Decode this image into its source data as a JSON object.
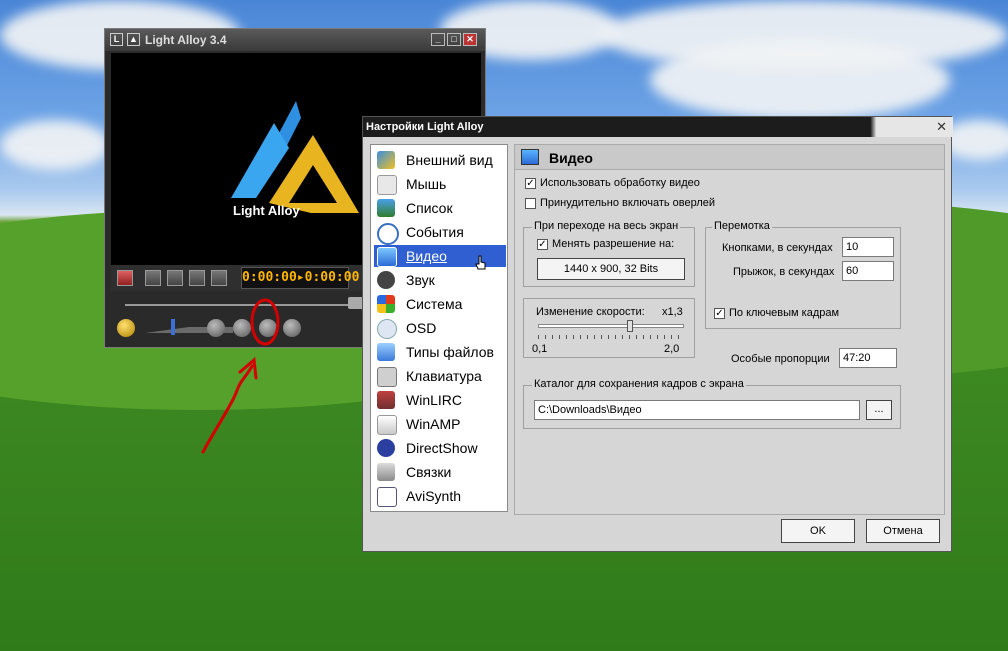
{
  "player": {
    "title": "Light Alloy 3.4",
    "logo_text": "Light Alloy",
    "time": "0:00:00▸0:00:00"
  },
  "dialog": {
    "title": "Настройки Light Alloy",
    "close_glyph": "✕",
    "sidebar": [
      {
        "label": "Внешний вид",
        "icon": "appearance-icon"
      },
      {
        "label": "Мышь",
        "icon": "mouse-icon"
      },
      {
        "label": "Список",
        "icon": "list-icon"
      },
      {
        "label": "События",
        "icon": "clock-icon"
      },
      {
        "label": "Видео",
        "icon": "monitor-icon",
        "selected": true
      },
      {
        "label": "Звук",
        "icon": "headphones-icon"
      },
      {
        "label": "Система",
        "icon": "windows-icon"
      },
      {
        "label": "OSD",
        "icon": "osd-icon"
      },
      {
        "label": "Типы файлов",
        "icon": "file-types-icon"
      },
      {
        "label": "Клавиатура",
        "icon": "keyboard-icon"
      },
      {
        "label": "WinLIRC",
        "icon": "remote-icon"
      },
      {
        "label": "WinAMP",
        "icon": "winamp-icon"
      },
      {
        "label": "DirectShow",
        "icon": "directshow-icon"
      },
      {
        "label": "Связки",
        "icon": "links-icon"
      },
      {
        "label": "AviSynth",
        "icon": "avisynth-icon"
      }
    ],
    "panel": {
      "heading": "Видео",
      "use_video_processing": {
        "label": "Использовать обработку видео",
        "checked": true
      },
      "force_overlay": {
        "label": "Принудительно включать оверлей",
        "checked": false
      },
      "fullscreen_group": {
        "title": "При переходе на весь экран",
        "change_resolution": {
          "label": "Менять разрешение на:",
          "checked": true
        },
        "resolution_button": "1440 x 900, 32 Bits"
      },
      "seek_group": {
        "title": "Перемотка",
        "buttons_label": "Кнопками, в секундах",
        "buttons_value": "10",
        "jump_label": "Прыжок, в секундах",
        "jump_value": "60",
        "keyframes": {
          "label": "По ключевым кадрам",
          "checked": true
        }
      },
      "speed": {
        "label": "Изменение скорости:",
        "value_label": "x1,3",
        "min_label": "0,1",
        "max_label": "2,0",
        "min": 0.1,
        "max": 2.0,
        "value": 1.3
      },
      "aspect": {
        "label": "Особые пропорции",
        "value": "47:20"
      },
      "snapshots": {
        "title": "Каталог для сохранения кадров с экрана",
        "path": "C:\\Downloads\\Видео",
        "browse": "..."
      }
    },
    "ok": "OK",
    "cancel": "Отмена"
  },
  "colors": {
    "selection": "#2f5fd0",
    "time_digits": "#ffb600",
    "annotation": "#d40000"
  }
}
